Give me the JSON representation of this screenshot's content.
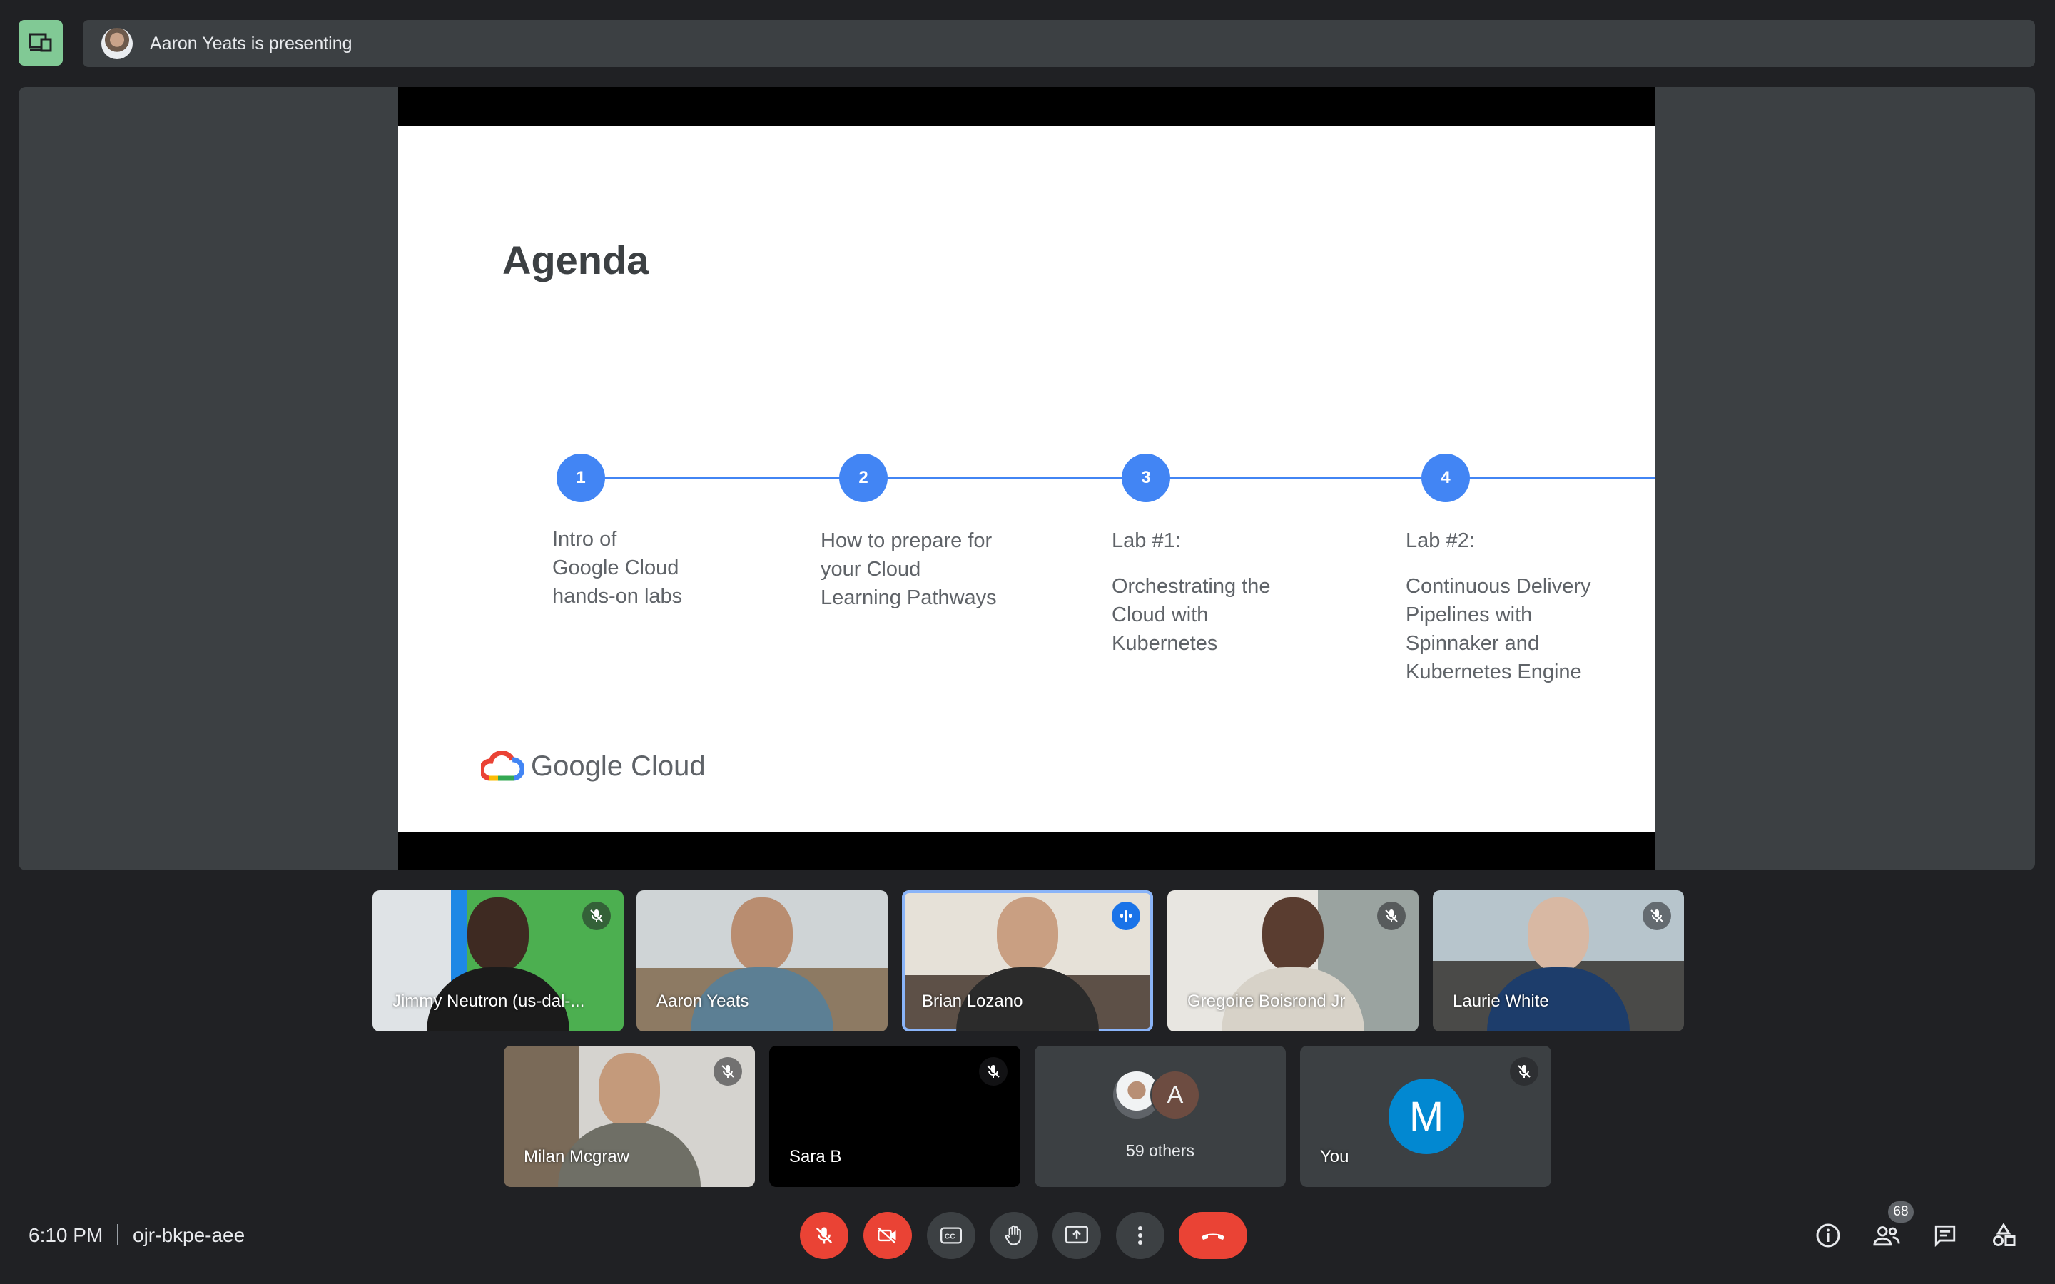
{
  "header": {
    "presenting_text": "Aaron Yeats is presenting"
  },
  "slide": {
    "title": "Agenda",
    "steps": [
      {
        "num": "1",
        "lines": [
          "Intro of",
          "Google Cloud",
          "hands-on labs"
        ]
      },
      {
        "num": "2",
        "lines": [
          "How to prepare for",
          "your Cloud",
          "Learning Pathways"
        ]
      },
      {
        "num": "3",
        "heading": "Lab #1:",
        "lines": [
          "Orchestrating the",
          "Cloud with",
          "Kubernetes"
        ]
      },
      {
        "num": "4",
        "heading": "Lab #2:",
        "lines": [
          "Continuous Delivery",
          "Pipelines with",
          "Spinnaker and",
          "Kubernetes Engine"
        ]
      }
    ],
    "logo_text": "Google Cloud"
  },
  "participants": [
    {
      "name": "Jimmy Neutron (us-dal-...",
      "muted": true
    },
    {
      "name": "Aaron Yeats",
      "muted": false
    },
    {
      "name": "Brian Lozano",
      "speaking": true
    },
    {
      "name": "Gregoire Boisrond Jr",
      "muted": true
    },
    {
      "name": "Laurie White",
      "muted": true
    },
    {
      "name": "Milan Mcgraw",
      "muted": true
    },
    {
      "name": "Sara B",
      "muted": true
    }
  ],
  "others": {
    "initial": "A",
    "label": "59 others"
  },
  "self_tile": {
    "initial": "M",
    "label": "You"
  },
  "footer": {
    "time": "6:10 PM",
    "meeting_code": "ojr-bkpe-aee",
    "participant_count": "68"
  },
  "colors": {
    "background": "#202124",
    "accent_blue": "#4285f4",
    "danger_red": "#ea4335",
    "present_green": "#81c995"
  }
}
